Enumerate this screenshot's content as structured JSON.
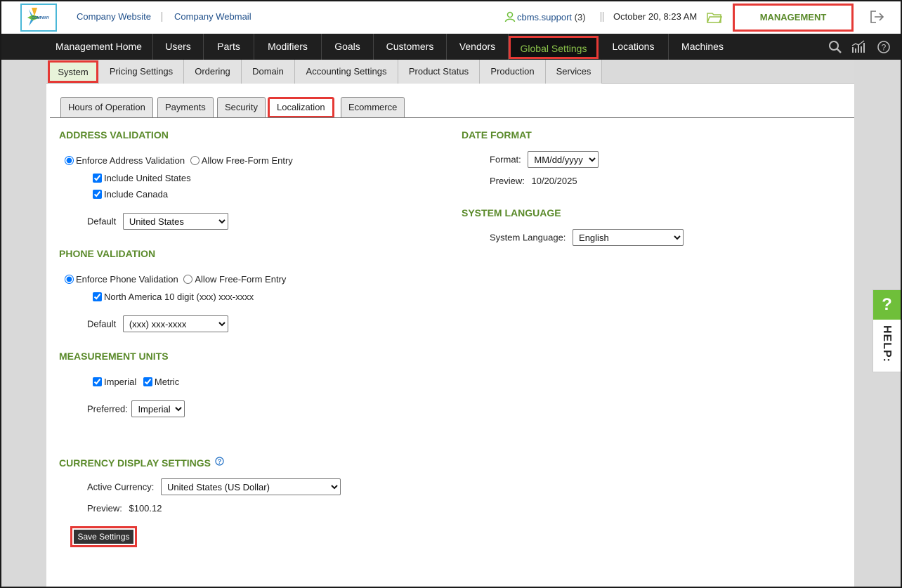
{
  "header": {
    "logo_text": "COMPANY",
    "company_website": "Company Website",
    "company_webmail": "Company Webmail",
    "user_name": "cbms.support",
    "user_count": "(3)",
    "datetime": "October 20, 8:23 AM",
    "management_label": "MANAGEMENT"
  },
  "main_nav": {
    "items": [
      {
        "label": "Management Home"
      },
      {
        "label": "Users"
      },
      {
        "label": "Parts"
      },
      {
        "label": "Modifiers"
      },
      {
        "label": "Goals"
      },
      {
        "label": "Customers"
      },
      {
        "label": "Vendors"
      },
      {
        "label": "Global Settings"
      },
      {
        "label": "Locations"
      },
      {
        "label": "Machines"
      }
    ],
    "active": "Global Settings"
  },
  "sub_nav": {
    "items": [
      {
        "label": "System"
      },
      {
        "label": "Pricing Settings"
      },
      {
        "label": "Ordering"
      },
      {
        "label": "Domain"
      },
      {
        "label": "Accounting Settings"
      },
      {
        "label": "Product Status"
      },
      {
        "label": "Production"
      },
      {
        "label": "Services"
      }
    ],
    "active": "System"
  },
  "tabs": {
    "items": [
      {
        "label": "Hours of Operation"
      },
      {
        "label": "Payments"
      },
      {
        "label": "Security"
      },
      {
        "label": "Localization"
      },
      {
        "label": "Ecommerce"
      }
    ],
    "active": "Localization"
  },
  "address_validation": {
    "title": "ADDRESS VALIDATION",
    "enforce_label": "Enforce Address Validation",
    "freeform_label": "Allow Free-Form Entry",
    "selected": "enforce",
    "include_us_label": "Include United States",
    "include_us": true,
    "include_canada_label": "Include Canada",
    "include_canada": true,
    "default_label": "Default",
    "default_value": "United States"
  },
  "phone_validation": {
    "title": "PHONE VALIDATION",
    "enforce_label": "Enforce Phone Validation",
    "freeform_label": "Allow Free-Form Entry",
    "selected": "enforce",
    "na_label": "North America 10 digit (xxx) xxx-xxxx",
    "na_checked": true,
    "default_label": "Default",
    "default_value": "(xxx) xxx-xxxx"
  },
  "measurement_units": {
    "title": "MEASUREMENT UNITS",
    "imperial_label": "Imperial",
    "imperial": true,
    "metric_label": "Metric",
    "metric": true,
    "preferred_label": "Preferred:",
    "preferred_value": "Imperial"
  },
  "currency": {
    "title": "CURRENCY DISPLAY SETTINGS",
    "active_label": "Active Currency:",
    "active_value": "United States (US Dollar)",
    "preview_label": "Preview:",
    "preview_value": "$100.12"
  },
  "date_format": {
    "title": "DATE FORMAT",
    "format_label": "Format:",
    "format_value": "MM/dd/yyyy",
    "preview_label": "Preview:",
    "preview_value": "10/20/2025"
  },
  "system_language": {
    "title": "SYSTEM LANGUAGE",
    "label": "System Language:",
    "value": "English"
  },
  "actions": {
    "save_label": "Save Settings"
  },
  "help": {
    "icon": "?",
    "label": "HELP:"
  },
  "colors": {
    "accent_green": "#5a8a2a",
    "highlight_red": "#e53935",
    "nav_bg": "#1f1f1f"
  }
}
